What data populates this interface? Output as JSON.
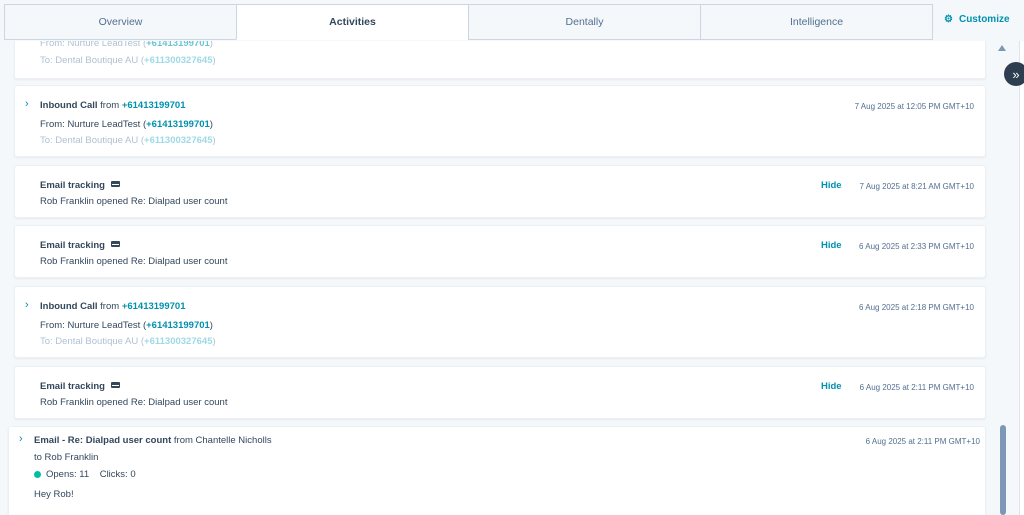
{
  "tabs": [
    "Overview",
    "Activities",
    "Dentally",
    "Intelligence"
  ],
  "active_tab": "Activities",
  "customize_label": "Customize",
  "cards": {
    "c0": {
      "from_name": "From: Nurture LeadTest (",
      "from_phone": "+61413199701",
      "to_name": "To: Dental Boutique AU (",
      "to_phone": "+611300327645"
    },
    "c1": {
      "title": "Inbound Call",
      "from_word": "from",
      "phone": "+61413199701",
      "from_name": "From: Nurture LeadTest (",
      "from_phone": "+61413199701",
      "to_name": "To: Dental Boutique AU (",
      "to_phone": "+611300327645",
      "timestamp": "7 Aug 2025 at 12:05 PM GMT+10"
    },
    "c2": {
      "title": "Email tracking",
      "body": "Rob Franklin opened Re: Dialpad user count",
      "hide": "Hide",
      "timestamp": "7 Aug 2025 at 8:21 AM GMT+10"
    },
    "c3": {
      "title": "Email tracking",
      "body": "Rob Franklin opened Re: Dialpad user count",
      "hide": "Hide",
      "timestamp": "6 Aug 2025 at 2:33 PM GMT+10"
    },
    "c4": {
      "title": "Inbound Call",
      "from_word": "from",
      "phone": "+61413199701",
      "from_name": "From: Nurture LeadTest (",
      "from_phone": "+61413199701",
      "to_name": "To: Dental Boutique AU (",
      "to_phone": "+611300327645",
      "timestamp": "6 Aug 2025 at 2:18 PM GMT+10"
    },
    "c5": {
      "title": "Email tracking",
      "body": "Rob Franklin opened Re: Dialpad user count",
      "hide": "Hide",
      "timestamp": "6 Aug 2025 at 2:11 PM GMT+10"
    },
    "c6": {
      "title": "Email - Re: Dialpad user count",
      "from_text": "from Chantelle Nicholls",
      "to_text": "to Rob Franklin",
      "opens": "Opens: 11",
      "clicks": "Clicks: 0",
      "body": "Hey Rob!",
      "timestamp": "6 Aug 2025 at 2:11 PM GMT+10"
    }
  },
  "close_paren": ")",
  "colors": {
    "accent": "#0091ae",
    "text": "#33475b",
    "opens_dot": "#00bda5"
  }
}
